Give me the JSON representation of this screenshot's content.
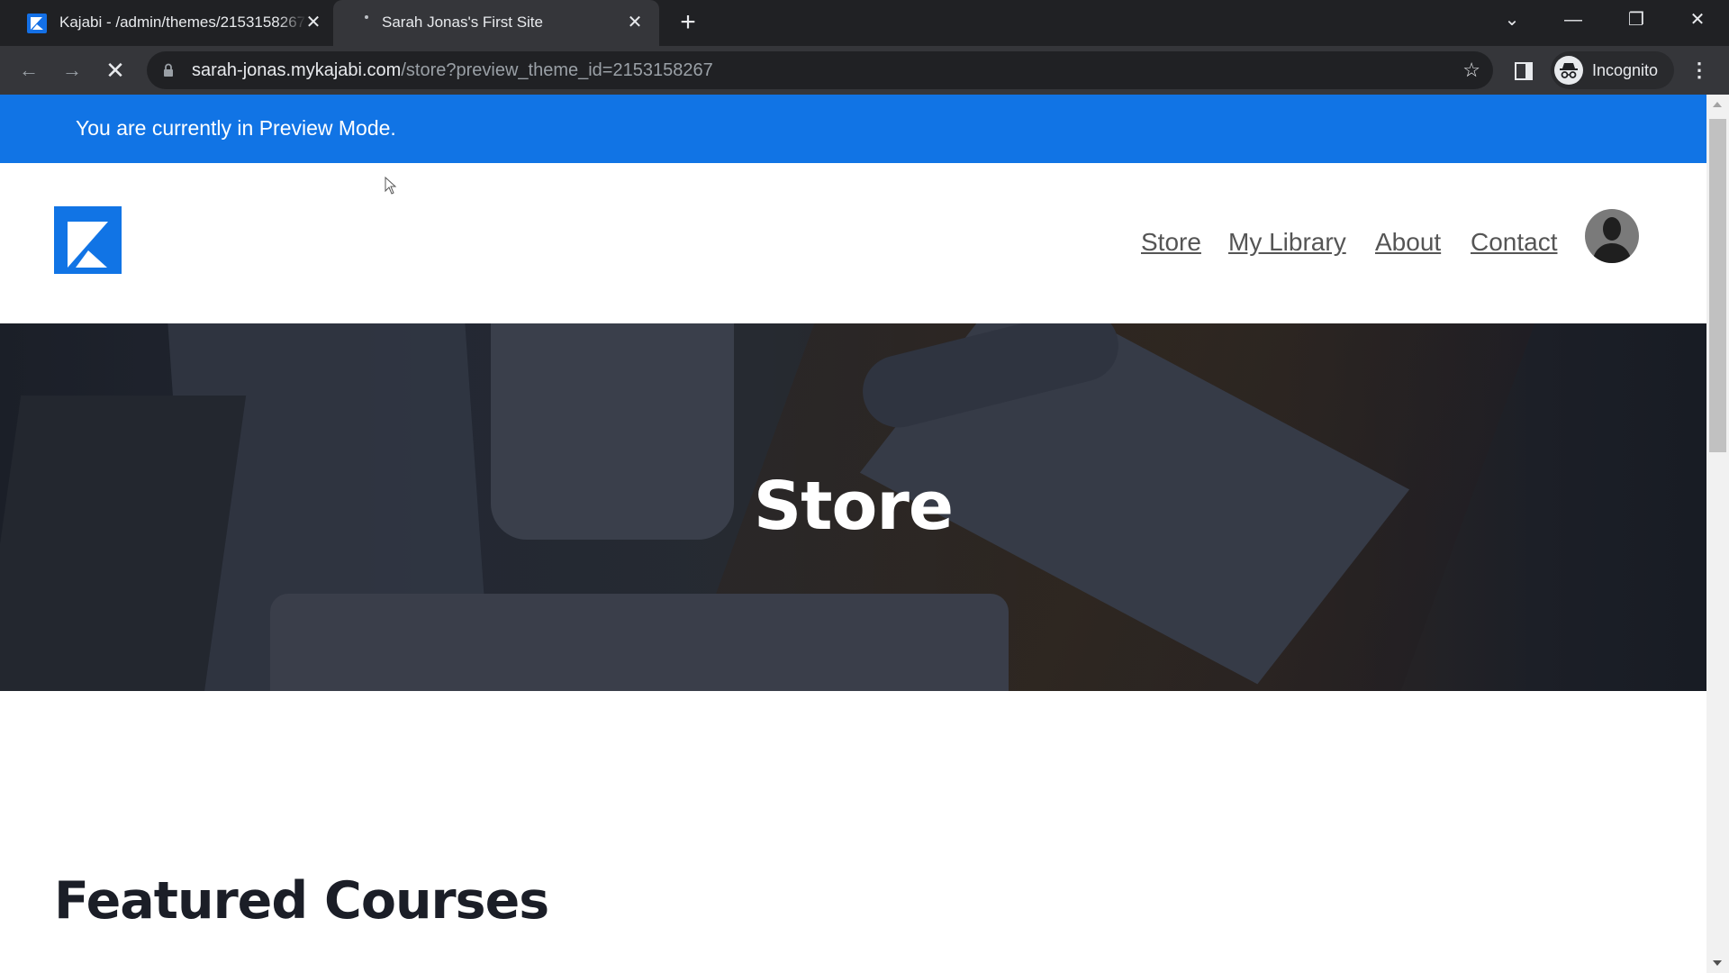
{
  "browser": {
    "tabs": [
      {
        "title": "Kajabi - /admin/themes/2153158267",
        "favicon": "kajabi-logo-icon",
        "active": false
      },
      {
        "title": "Sarah Jonas's First Site",
        "favicon": "loading-icon",
        "active": true
      }
    ],
    "new_tab_label": "+",
    "window_controls": {
      "tab_search": "⌄",
      "minimize": "—",
      "restore": "❐",
      "close": "✕"
    },
    "nav": {
      "back": "←",
      "forward": "→",
      "stop": "✕"
    },
    "url": {
      "host": "sarah-jonas.mykajabi.com",
      "path": "/store?preview_theme_id=2153158267"
    },
    "bookmark_icon": "☆",
    "profile_label": "Incognito",
    "menu_icon": "⋮"
  },
  "page": {
    "preview_banner": "You are currently in Preview Mode.",
    "nav_items": [
      "Store",
      "My Library",
      "About",
      "Contact"
    ],
    "hero_title": "Store",
    "section_title": "Featured Courses"
  },
  "colors": {
    "brand_blue": "#1174e5",
    "heading_dark": "#1b1e27",
    "nav_text": "#555555"
  }
}
